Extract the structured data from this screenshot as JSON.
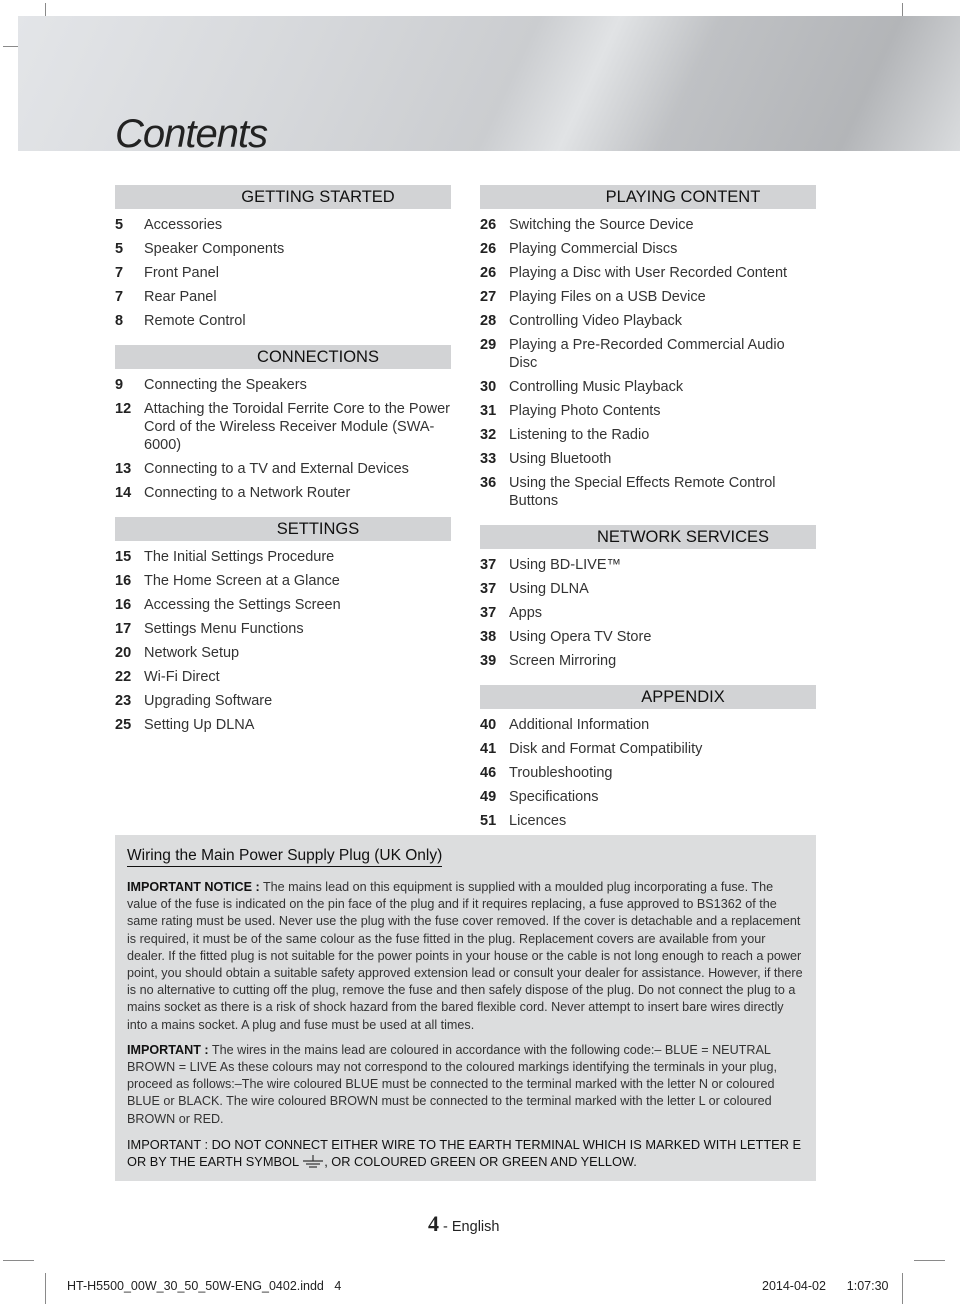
{
  "page": {
    "title": "Contents",
    "page_number": "4",
    "page_suffix": "- English"
  },
  "toc_left": [
    {
      "heading": "GETTING STARTED",
      "items": [
        {
          "page": "5",
          "label": "Accessories"
        },
        {
          "page": "5",
          "label": "Speaker Components"
        },
        {
          "page": "7",
          "label": "Front Panel"
        },
        {
          "page": "7",
          "label": "Rear Panel"
        },
        {
          "page": "8",
          "label": "Remote Control"
        }
      ]
    },
    {
      "heading": "CONNECTIONS",
      "items": [
        {
          "page": "9",
          "label": "Connecting the Speakers"
        },
        {
          "page": "12",
          "label": "Attaching the Toroidal Ferrite Core to the Power Cord of the Wireless Receiver Module (SWA-6000)"
        },
        {
          "page": "13",
          "label": "Connecting to a TV and External Devices"
        },
        {
          "page": "14",
          "label": "Connecting to a Network Router"
        }
      ]
    },
    {
      "heading": "SETTINGS",
      "items": [
        {
          "page": "15",
          "label": "The Initial Settings Procedure"
        },
        {
          "page": "16",
          "label": "The Home Screen at a Glance"
        },
        {
          "page": "16",
          "label": "Accessing the Settings Screen"
        },
        {
          "page": "17",
          "label": "Settings Menu Functions"
        },
        {
          "page": "20",
          "label": "Network Setup"
        },
        {
          "page": "22",
          "label": "Wi-Fi Direct"
        },
        {
          "page": "23",
          "label": "Upgrading Software"
        },
        {
          "page": "25",
          "label": "Setting Up DLNA"
        }
      ]
    }
  ],
  "toc_right": [
    {
      "heading": "PLAYING CONTENT",
      "items": [
        {
          "page": "26",
          "label": "Switching the Source Device"
        },
        {
          "page": "26",
          "label": "Playing Commercial Discs"
        },
        {
          "page": "26",
          "label": "Playing a Disc with User Recorded Content"
        },
        {
          "page": "27",
          "label": "Playing Files on a USB Device"
        },
        {
          "page": "28",
          "label": "Controlling Video Playback"
        },
        {
          "page": "29",
          "label": "Playing a Pre-Recorded Commercial Audio Disc"
        },
        {
          "page": "30",
          "label": "Controlling Music Playback"
        },
        {
          "page": "31",
          "label": "Playing Photo Contents"
        },
        {
          "page": "32",
          "label": "Listening to the Radio"
        },
        {
          "page": "33",
          "label": "Using Bluetooth"
        },
        {
          "page": "36",
          "label": "Using the Special Effects Remote Control Buttons"
        }
      ]
    },
    {
      "heading": "NETWORK SERVICES",
      "items": [
        {
          "page": "37",
          "label": "Using BD-LIVE™"
        },
        {
          "page": "37",
          "label": "Using DLNA"
        },
        {
          "page": "37",
          "label": "Apps"
        },
        {
          "page": "38",
          "label": "Using Opera TV Store"
        },
        {
          "page": "39",
          "label": "Screen Mirroring"
        }
      ]
    },
    {
      "heading": "APPENDIX",
      "items": [
        {
          "page": "40",
          "label": "Additional Information"
        },
        {
          "page": "41",
          "label": "Disk and Format Compatibility"
        },
        {
          "page": "46",
          "label": "Troubleshooting"
        },
        {
          "page": "49",
          "label": "Specifications"
        },
        {
          "page": "51",
          "label": "Licences"
        }
      ]
    }
  ],
  "notice": {
    "title": "Wiring the Main Power Supply Plug (UK Only)",
    "p1_lead": "IMPORTANT NOTICE :",
    "p1_text": " The mains lead on this equipment is supplied with a moulded plug incorporating a fuse. The value of the fuse is indicated on the pin face of the plug and if it requires replacing, a fuse approved to BS1362 of the same rating must be used. Never use the plug with the fuse cover removed. If the cover is detachable and a replacement is required, it must be of the same colour as the fuse fitted in the plug. Replacement covers are available from your dealer. If the fitted plug is not suitable for the power points in your house or the cable is not long enough to reach a power point, you should obtain a suitable safety approved extension lead or consult your dealer for assistance. However, if there is no alternative to cutting off the plug, remove the fuse and then safely dispose of the plug. Do not connect the plug to a mains socket as there is a risk of shock hazard from the bared flexible cord. Never attempt to insert bare wires directly into a mains socket. A plug and fuse must be used at all times.",
    "p2_lead": "IMPORTANT :",
    "p2_text": " The wires in the mains lead are coloured in accordance with the following code:– BLUE = NEUTRAL BROWN = LIVE As these colours may not correspond to the coloured markings identifying the terminals in your plug, proceed as follows:–The wire coloured BLUE must be connected to the terminal marked with the letter N or coloured BLUE or BLACK. The wire coloured BROWN must be connected to the terminal marked with the letter L or coloured BROWN or RED.",
    "p3_before": "IMPORTANT : DO NOT CONNECT EITHER WIRE TO THE EARTH TERMINAL WHICH IS MARKED WITH LETTER E OR BY THE EARTH SYMBOL ",
    "p3_icon": "earth-ground-icon",
    "p3_after": ", OR COLOURED GREEN OR GREEN AND YELLOW."
  },
  "slug": {
    "filename": "HT-H5500_00W_30_50_50W-ENG_0402.indd",
    "page": "4",
    "date": "2014-04-02",
    "time": "1:07:30"
  }
}
